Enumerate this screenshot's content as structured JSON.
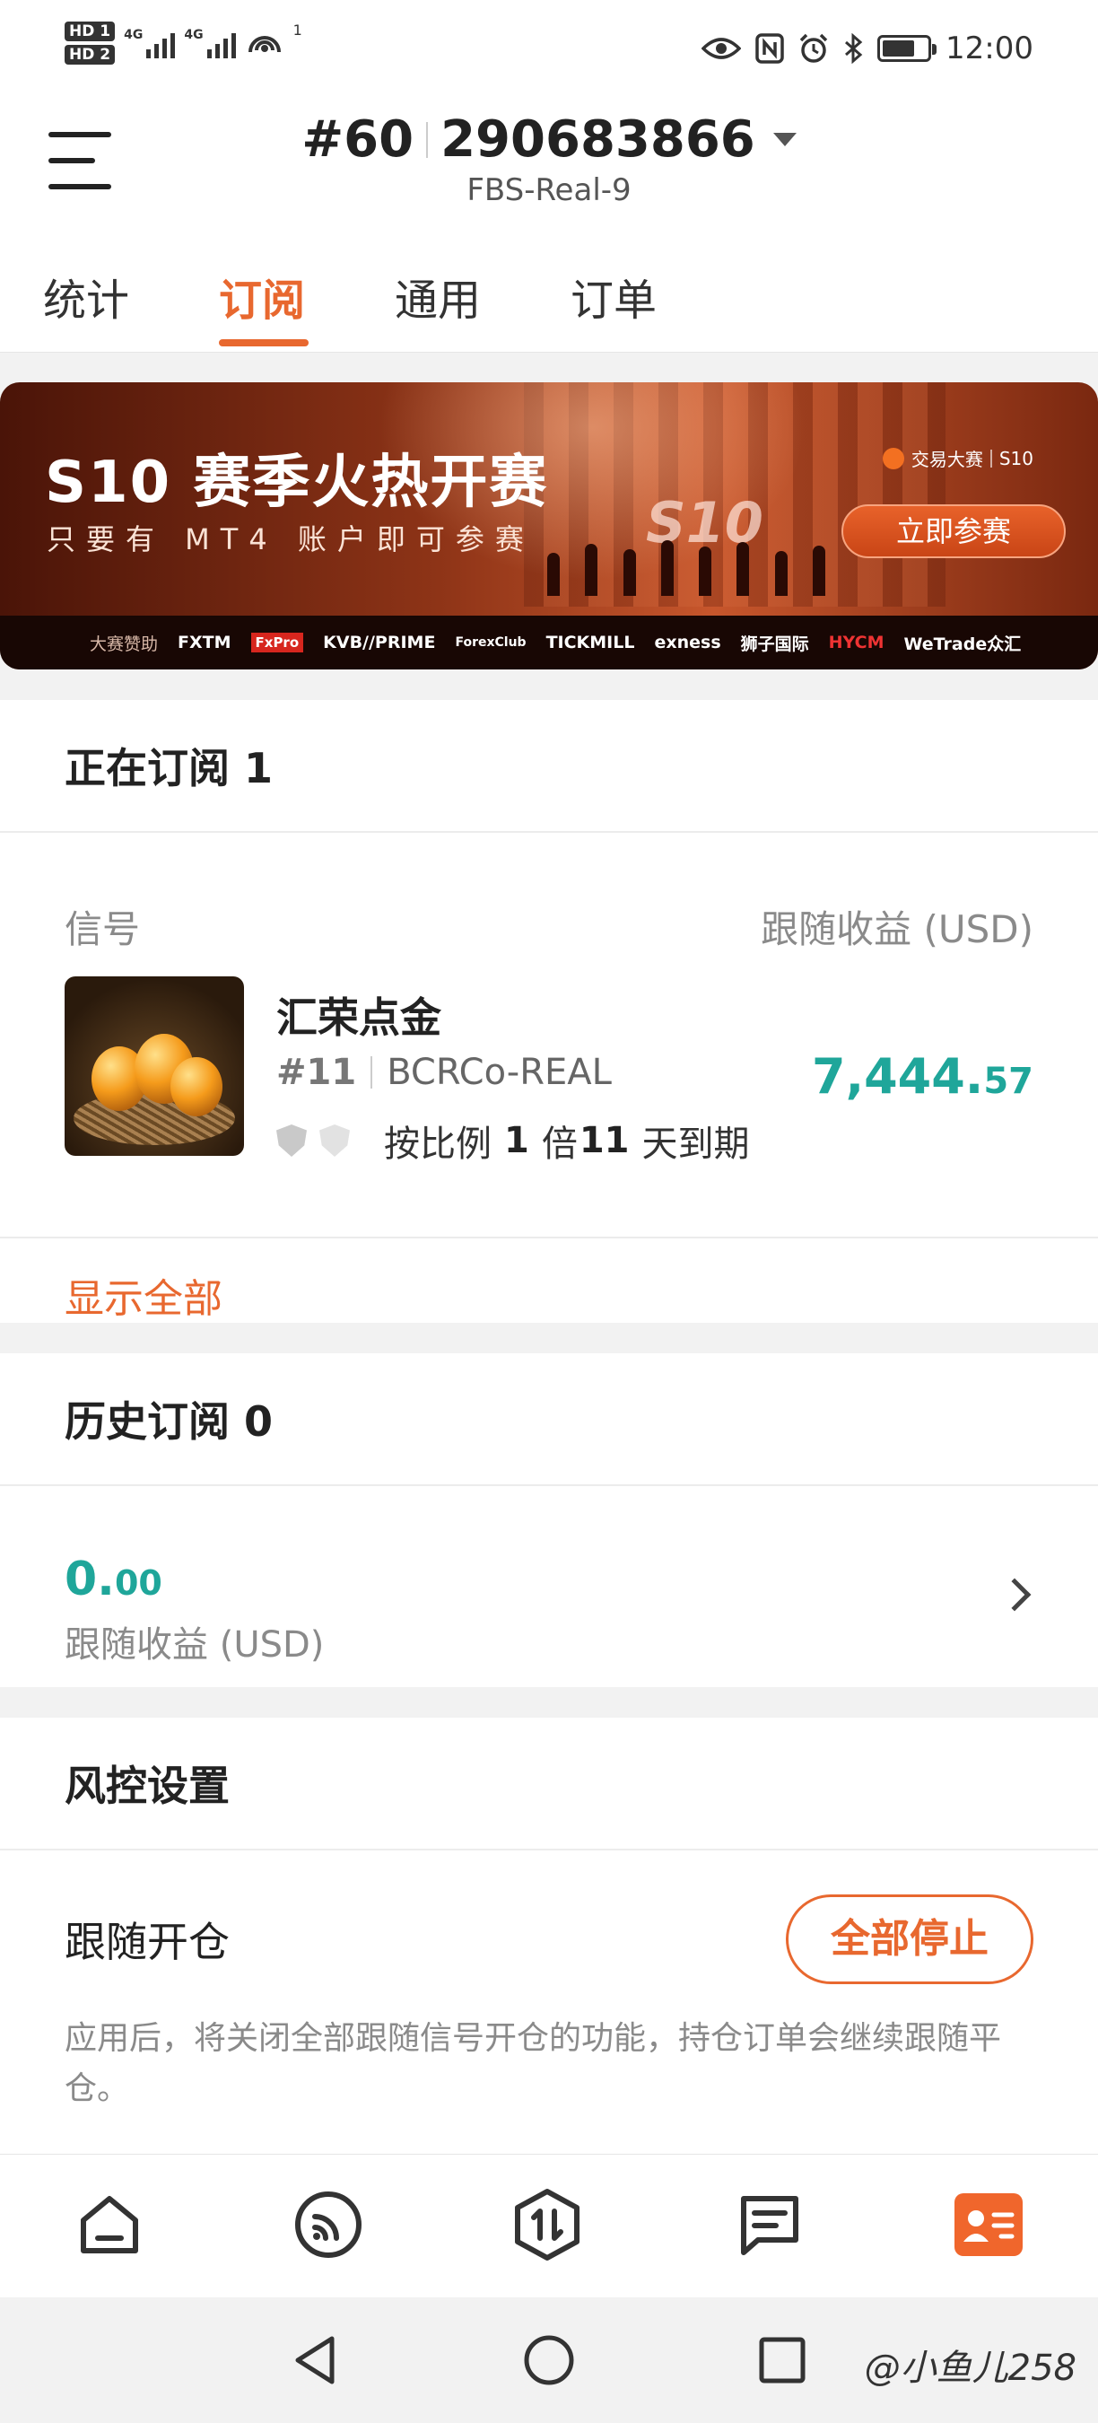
{
  "status_bar": {
    "hd1": "HD 1",
    "hd2": "HD 2",
    "net1": "4G",
    "net2": "4G",
    "hotspot_count": "1",
    "time": "12:00"
  },
  "header": {
    "account_rank": "#60",
    "account_number": "290683866",
    "server": "FBS-Real-9"
  },
  "tabs": [
    {
      "label": "统计",
      "active": false
    },
    {
      "label": "订阅",
      "active": true
    },
    {
      "label": "通用",
      "active": false
    },
    {
      "label": "订单",
      "active": false
    }
  ],
  "banner": {
    "title": "S10 赛季火热开赛",
    "subtitle": "只要有 MT4 账户即可参赛",
    "brand": "交易大赛",
    "season": "S10",
    "join_label": "立即参赛",
    "sponsor_label": "大赛赞助",
    "sponsors": [
      "FXTM",
      "FxPro",
      "KVB//PRIME",
      "ForexClub",
      "TICKMILL",
      "exness",
      "狮子国际",
      "HYCM",
      "WeTrade众汇"
    ]
  },
  "active_subscriptions": {
    "title": "正在订阅 1",
    "col_signal": "信号",
    "col_profit": "跟随收益 (USD)",
    "item": {
      "name": "汇荣点金",
      "rank": "#11",
      "server": "BCRCo-REAL",
      "ratio_prefix": "按比例",
      "ratio_value": "1",
      "ratio_unit": "倍",
      "days": "11",
      "days_suffix": "天到期",
      "profit_int": "7,444.",
      "profit_dec": "57"
    },
    "show_all": "显示全部"
  },
  "history": {
    "title": "历史订阅 0",
    "value_int": "0.",
    "value_dec": "00",
    "label": "跟随收益 (USD)"
  },
  "risk": {
    "title": "风控设置",
    "follow_label": "跟随开仓",
    "stop_all": "全部停止",
    "note": "应用后，将关闭全部跟随信号开仓的功能，持仓订单会继续跟随平仓。"
  },
  "bottom_nav": [
    {
      "icon": "home-icon",
      "active": false
    },
    {
      "icon": "signal-icon",
      "active": false
    },
    {
      "icon": "trade-icon",
      "active": false
    },
    {
      "icon": "message-icon",
      "active": false
    },
    {
      "icon": "profile-icon",
      "active": true
    }
  ],
  "watermark": "@小鱼儿258",
  "colors": {
    "accent": "#e8682f",
    "profit": "#1fa69a"
  }
}
